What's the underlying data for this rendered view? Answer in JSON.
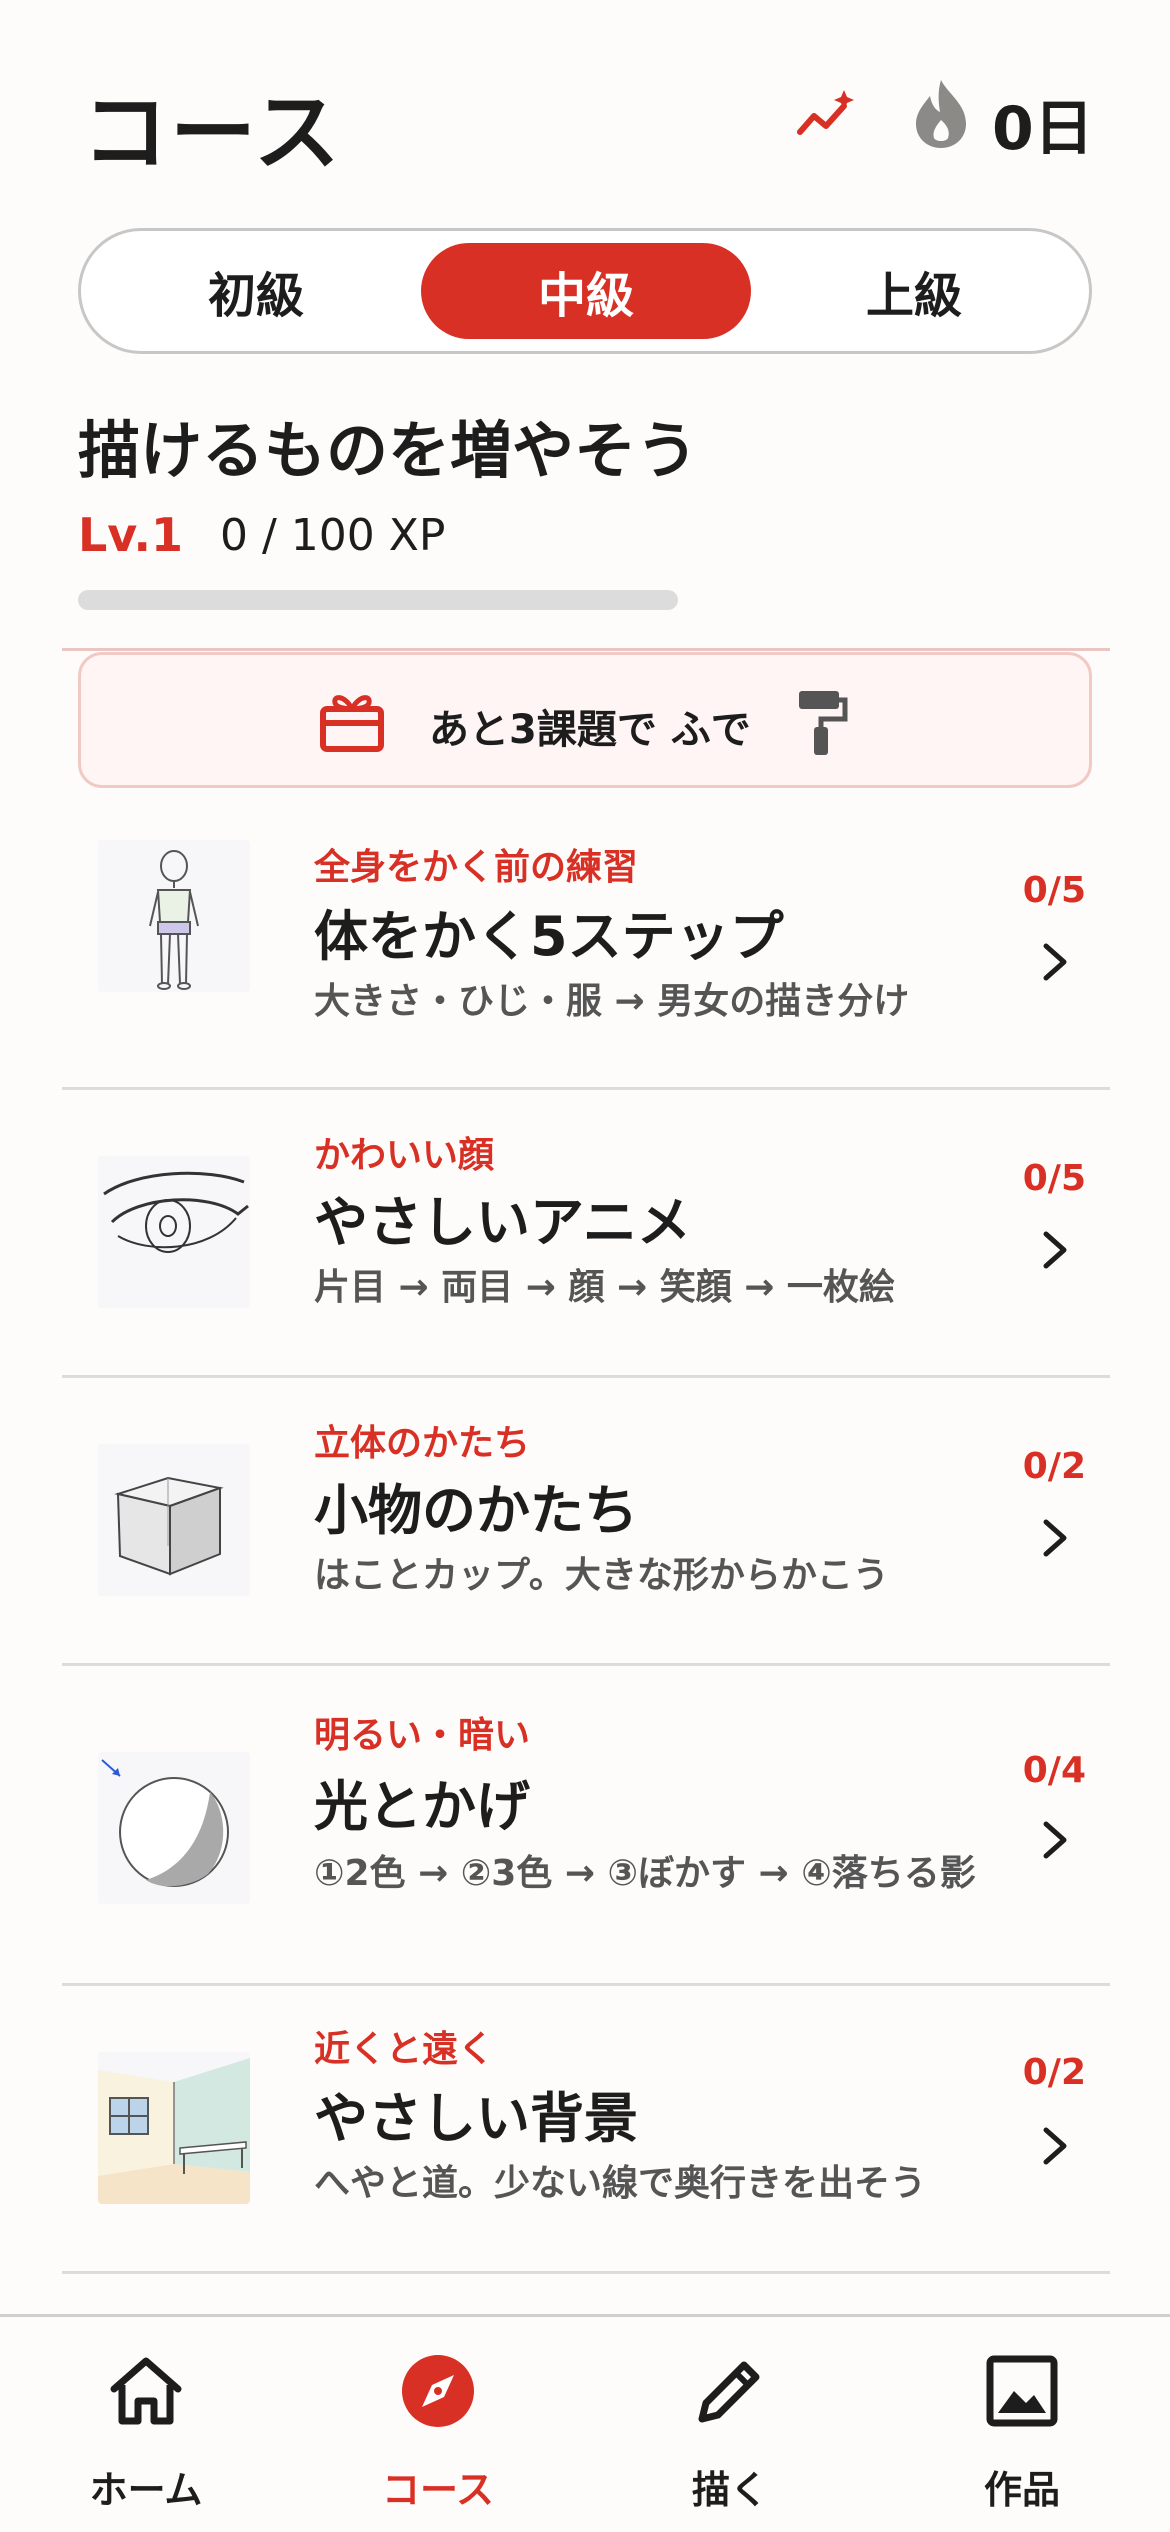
{
  "header": {
    "title": "コース",
    "streak": "0日"
  },
  "levels": {
    "tabs": [
      "初級",
      "中級",
      "上級"
    ],
    "selected": "中級"
  },
  "course": {
    "heading": "描けるものを増やそう",
    "level": "Lv.1",
    "xp_text": "0 / 100 XP",
    "xp_progress": 0
  },
  "reward": {
    "text": "あと3課題で ふで"
  },
  "courses": [
    {
      "category": "全身をかく前の練習",
      "title": "体をかく5ステップ",
      "description": "大きさ・ひじ・服 → 男女の描き分け",
      "progress": "0/5",
      "thumbnail": "body-figure"
    },
    {
      "category": "かわいい顔",
      "title": "やさしいアニメ",
      "description": "片目 → 両目 → 顔 → 笑顔 → 一枚絵",
      "progress": "0/5",
      "thumbnail": "anime-eye"
    },
    {
      "category": "立体のかたち",
      "title": "小物のかたち",
      "description": "はことカップ。大きな形からかこう",
      "progress": "0/2",
      "thumbnail": "cube"
    },
    {
      "category": "明るい・暗い",
      "title": "光とかげ",
      "description": "①2色 → ②3色 → ③ぼかす → ④落ちる影",
      "progress": "0/4",
      "thumbnail": "shaded-sphere"
    },
    {
      "category": "近くと遠く",
      "title": "やさしい背景",
      "description": "へやと道。少ない線で奥行きを出そう",
      "progress": "0/2",
      "thumbnail": "room-perspective"
    }
  ],
  "nav": {
    "items": [
      {
        "label": "ホーム",
        "icon": "home-icon"
      },
      {
        "label": "コース",
        "icon": "compass-icon"
      },
      {
        "label": "描く",
        "icon": "pencil-icon"
      },
      {
        "label": "作品",
        "icon": "gallery-icon"
      }
    ],
    "active": "コース"
  },
  "colors": {
    "accent": "#d93025",
    "background": "#fdfcfa",
    "text": "#1d1d1d",
    "muted": "#555555"
  }
}
